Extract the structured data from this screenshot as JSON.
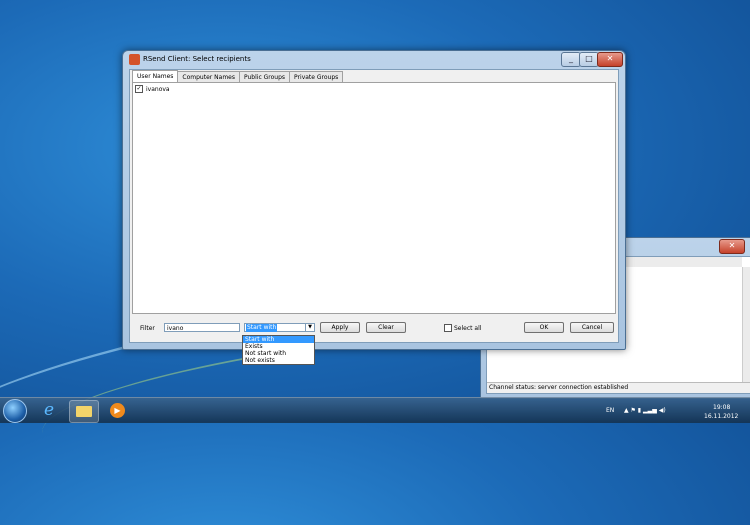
{
  "window": {
    "title": "RSend Client: Select recipients",
    "tabs": [
      "User Names",
      "Computer Names",
      "Public Groups",
      "Private Groups"
    ],
    "list": [
      {
        "label": "ivanova",
        "checked": true
      }
    ],
    "filter_label": "Filter",
    "filter_value": "ivano",
    "combo_value": "Start with",
    "combo_options": [
      "Start with",
      "Exists",
      "Not start with",
      "Not exists"
    ],
    "apply_label": "Apply",
    "clear_label": "Clear",
    "select_all_label": "Select all",
    "ok_label": "OK",
    "cancel_label": "Cancel",
    "close_glyph": "✕",
    "check_glyph": "✓"
  },
  "window2": {
    "status": "Channel status: server connection established",
    "close_glyph": "✕"
  },
  "taskbar": {
    "language": "EN",
    "time": "19:08",
    "date": "16.11.2012",
    "tray_glyphs": "▲ ⚑ ▮ ▂▃▅ ◀)"
  }
}
